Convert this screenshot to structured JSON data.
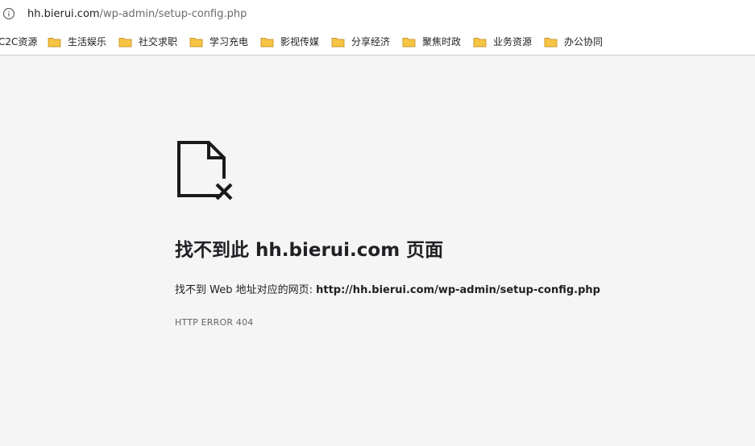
{
  "address_bar": {
    "host": "hh.bierui.com",
    "path": "/wp-admin/setup-config.php",
    "icon": "info-icon"
  },
  "bookmarks": [
    {
      "label": "C2C资源",
      "icon": "none"
    },
    {
      "label": "生活娱乐",
      "icon": "folder-icon"
    },
    {
      "label": "社交求职",
      "icon": "folder-icon"
    },
    {
      "label": "学习充电",
      "icon": "folder-icon"
    },
    {
      "label": "影视传媒",
      "icon": "folder-icon"
    },
    {
      "label": "分享经济",
      "icon": "folder-icon"
    },
    {
      "label": "聚焦时政",
      "icon": "folder-icon"
    },
    {
      "label": "业务资源",
      "icon": "folder-icon"
    },
    {
      "label": "办公协同",
      "icon": "folder-icon"
    }
  ],
  "error": {
    "icon": "broken-document-icon",
    "title": "找不到此 hh.bierui.com 页面",
    "description_prefix": "找不到 Web 地址对应的网页: ",
    "url": "http://hh.bierui.com/wp-admin/setup-config.php",
    "code": "HTTP ERROR 404"
  },
  "colors": {
    "background": "#f5f5f5",
    "folder": "#f6c544",
    "text": "#202124",
    "muted": "#646464"
  }
}
